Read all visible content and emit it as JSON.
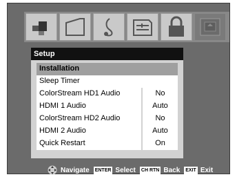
{
  "tabs": [
    {
      "icon": "picture-settings-icon"
    },
    {
      "icon": "screen-size-icon"
    },
    {
      "icon": "audio-music-icon"
    },
    {
      "icon": "preferences-icon"
    },
    {
      "icon": "lock-icon"
    },
    {
      "icon": "setup-tv-icon",
      "active": true
    }
  ],
  "menu": {
    "title": "Setup",
    "items": [
      {
        "label": "Installation"
      },
      {
        "label": "Sleep Timer"
      },
      {
        "label": "ColorStream HD1 Audio",
        "value": "No"
      },
      {
        "label": "HDMI 1 Audio",
        "value": "Auto"
      },
      {
        "label": "ColorStream HD2 Audio",
        "value": "No"
      },
      {
        "label": "HDMI 2 Audio",
        "value": "Auto"
      },
      {
        "label": "Quick Restart",
        "value": "On"
      }
    ]
  },
  "footer": {
    "navigate": "Navigate",
    "enter_key": "ENTER",
    "select": "Select",
    "chrtn_key": "CH RTN",
    "back": "Back",
    "exit_key": "EXIT",
    "exit": "Exit"
  }
}
